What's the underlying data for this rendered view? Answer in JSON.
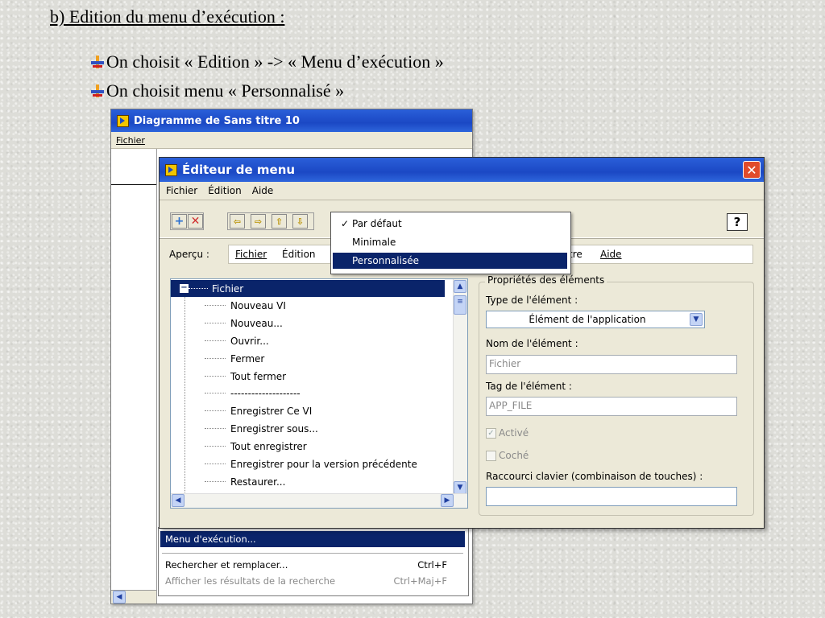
{
  "slide": {
    "title": "b) Edition du menu d’exécution :",
    "bullets": [
      "On choisit « Edition » -> « Menu d’exécution »",
      "On choisit menu « Personnalisé »"
    ]
  },
  "back_window": {
    "title": "Diagramme de Sans titre 10",
    "menubar_first": "Fichier",
    "dropdown": {
      "selected_item": "Menu d'exécution...",
      "item2_label": "Rechercher et remplacer...",
      "item2_shortcut": "Ctrl+F",
      "item3_label": "Afficher les résultats de la recherche",
      "item3_shortcut": "Ctrl+Maj+F"
    }
  },
  "editor": {
    "title": "Éditeur de menu",
    "close_glyph": "✕",
    "menubar": [
      "Fichier",
      "Édition",
      "Aide"
    ],
    "help_glyph": "?",
    "menu_type_popup": {
      "items": [
        "Par défaut",
        "Minimale",
        "Personnalisée"
      ],
      "checked": "✓",
      "selected": "Personnalisée"
    },
    "apercu_label": "Aperçu :",
    "apercu_items": [
      "Fichier",
      "Édition",
      "tre",
      "Aide"
    ],
    "tree": {
      "root": "Fichier",
      "items": [
        "Nouveau VI",
        "Nouveau...",
        "Ouvrir...",
        "Fermer",
        "Tout fermer",
        "--------------------",
        "Enregistrer Ce VI",
        "Enregistrer sous...",
        "Tout enregistrer",
        "Enregistrer pour la version précédente",
        "Restaurer..."
      ]
    },
    "properties": {
      "legend": "Propriétés des éléments",
      "type_label": "Type de l'élément :",
      "type_value": "Élément de l'application",
      "name_label": "Nom de l'élément :",
      "name_value": "Fichier",
      "tag_label": "Tag de l'élément :",
      "tag_value": "APP_FILE",
      "active_label": "Activé",
      "checked_label": "Coché",
      "shortcut_label": "Raccourci clavier (combinaison de touches) :",
      "shortcut_value": ""
    }
  },
  "colors": {
    "titlebar": "#1b48c4",
    "selection": "#0a246a",
    "dialog_bg": "#ece9d8",
    "close_button": "#e14b2a"
  }
}
